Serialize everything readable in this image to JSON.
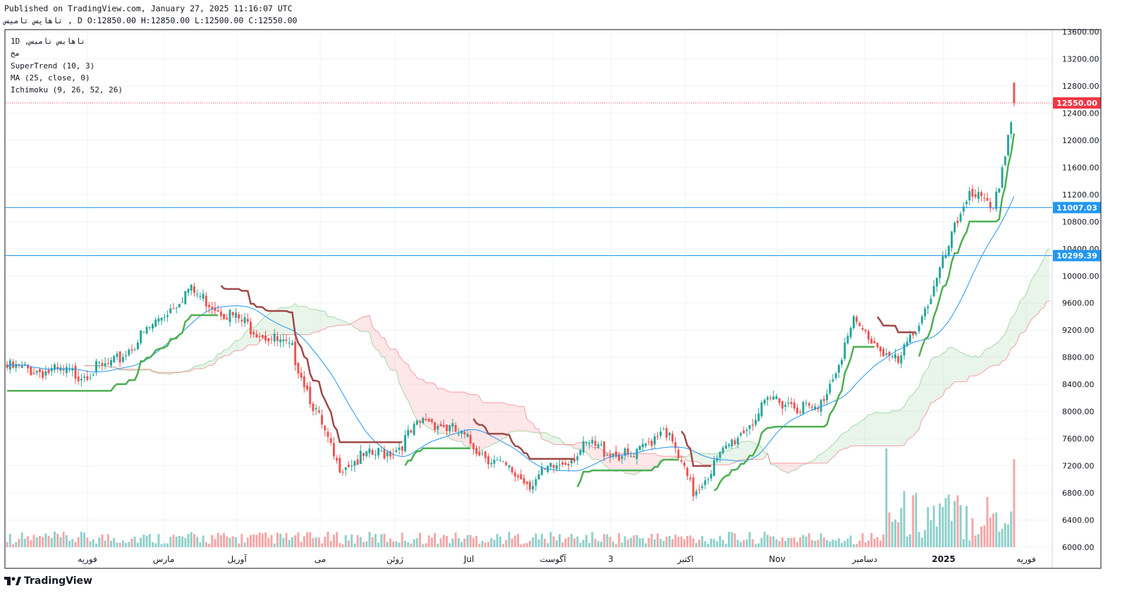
{
  "header": {
    "published": "Published on TradingView.com, January 27, 2025 11:16:07 UTC",
    "ohlc": "تاهایس تامیس , D O:12850.00 H:12850.00 L:12500.00 C:12550.00"
  },
  "legend": {
    "symbol": "1D ,تاهایس تامیس",
    "exchange": "مخ",
    "supertrend": "SuperTrend (10, 3)",
    "ma": "MA (25, close, 0)",
    "ichimoku": "Ichimoku (9, 26, 52, 26)"
  },
  "footer": {
    "brand": "TradingView"
  },
  "colors": {
    "up": "#26a69a",
    "down": "#ef5350",
    "ma": "#2196f3",
    "st_up": "#4caf50",
    "st_down": "#a04848",
    "hline": "#2196f3",
    "last_price": "#f23645",
    "vol_up": "#8fd0ca",
    "vol_down": "#f4a6a6"
  },
  "chart_data": {
    "type": "candlestick",
    "y_ticks": [
      "6000.00",
      "6400.00",
      "6800.00",
      "7200.00",
      "7600.00",
      "8000.00",
      "8400.00",
      "8800.00",
      "9200.00",
      "9600.00",
      "10000.00",
      "10400.00",
      "10800.00",
      "11200.00",
      "11600.00",
      "12000.00",
      "12400.00",
      "12800.00",
      "13200.00",
      "13600.00"
    ],
    "ylim": [
      6000,
      13800
    ],
    "x_labels": [
      "فوریه",
      "مارس",
      "آوریل",
      "می",
      "ژوئن",
      "Jul",
      "آگوست",
      "3",
      "اکتبر",
      "Nov",
      "دسامبر",
      "2025",
      "فوریه"
    ],
    "horizontal_lines": [
      {
        "label": "11007.03",
        "value": 11007.03
      },
      {
        "label": "10299.39",
        "value": 10299.39
      }
    ],
    "last_price": {
      "label": "12550.00",
      "value": 12550
    },
    "path_segments": [
      {
        "n": 25,
        "from": 8650,
        "to": 8550
      },
      {
        "n": 12,
        "from": 8550,
        "to": 8700
      },
      {
        "n": 25,
        "from": 8700,
        "to": 9800
      },
      {
        "n": 15,
        "from": 9800,
        "to": 9400
      },
      {
        "n": 20,
        "from": 9400,
        "to": 8900
      },
      {
        "n": 15,
        "from": 8900,
        "to": 7200
      },
      {
        "n": 20,
        "from": 7200,
        "to": 7450
      },
      {
        "n": 10,
        "from": 7450,
        "to": 7900
      },
      {
        "n": 10,
        "from": 7900,
        "to": 7700
      },
      {
        "n": 15,
        "from": 7700,
        "to": 7200
      },
      {
        "n": 10,
        "from": 7200,
        "to": 6950
      },
      {
        "n": 20,
        "from": 6950,
        "to": 7500
      },
      {
        "n": 15,
        "from": 7500,
        "to": 7300
      },
      {
        "n": 10,
        "from": 7300,
        "to": 7800
      },
      {
        "n": 10,
        "from": 7800,
        "to": 6800
      },
      {
        "n": 12,
        "from": 6800,
        "to": 7500
      },
      {
        "n": 15,
        "from": 7500,
        "to": 8200
      },
      {
        "n": 15,
        "from": 8200,
        "to": 8000
      },
      {
        "n": 12,
        "from": 8000,
        "to": 9300
      },
      {
        "n": 15,
        "from": 9300,
        "to": 8700
      },
      {
        "n": 12,
        "from": 8700,
        "to": 9800
      },
      {
        "n": 12,
        "from": 9800,
        "to": 11300
      },
      {
        "n": 8,
        "from": 11300,
        "to": 10900
      },
      {
        "n": 7,
        "from": 10900,
        "to": 12550
      }
    ]
  }
}
